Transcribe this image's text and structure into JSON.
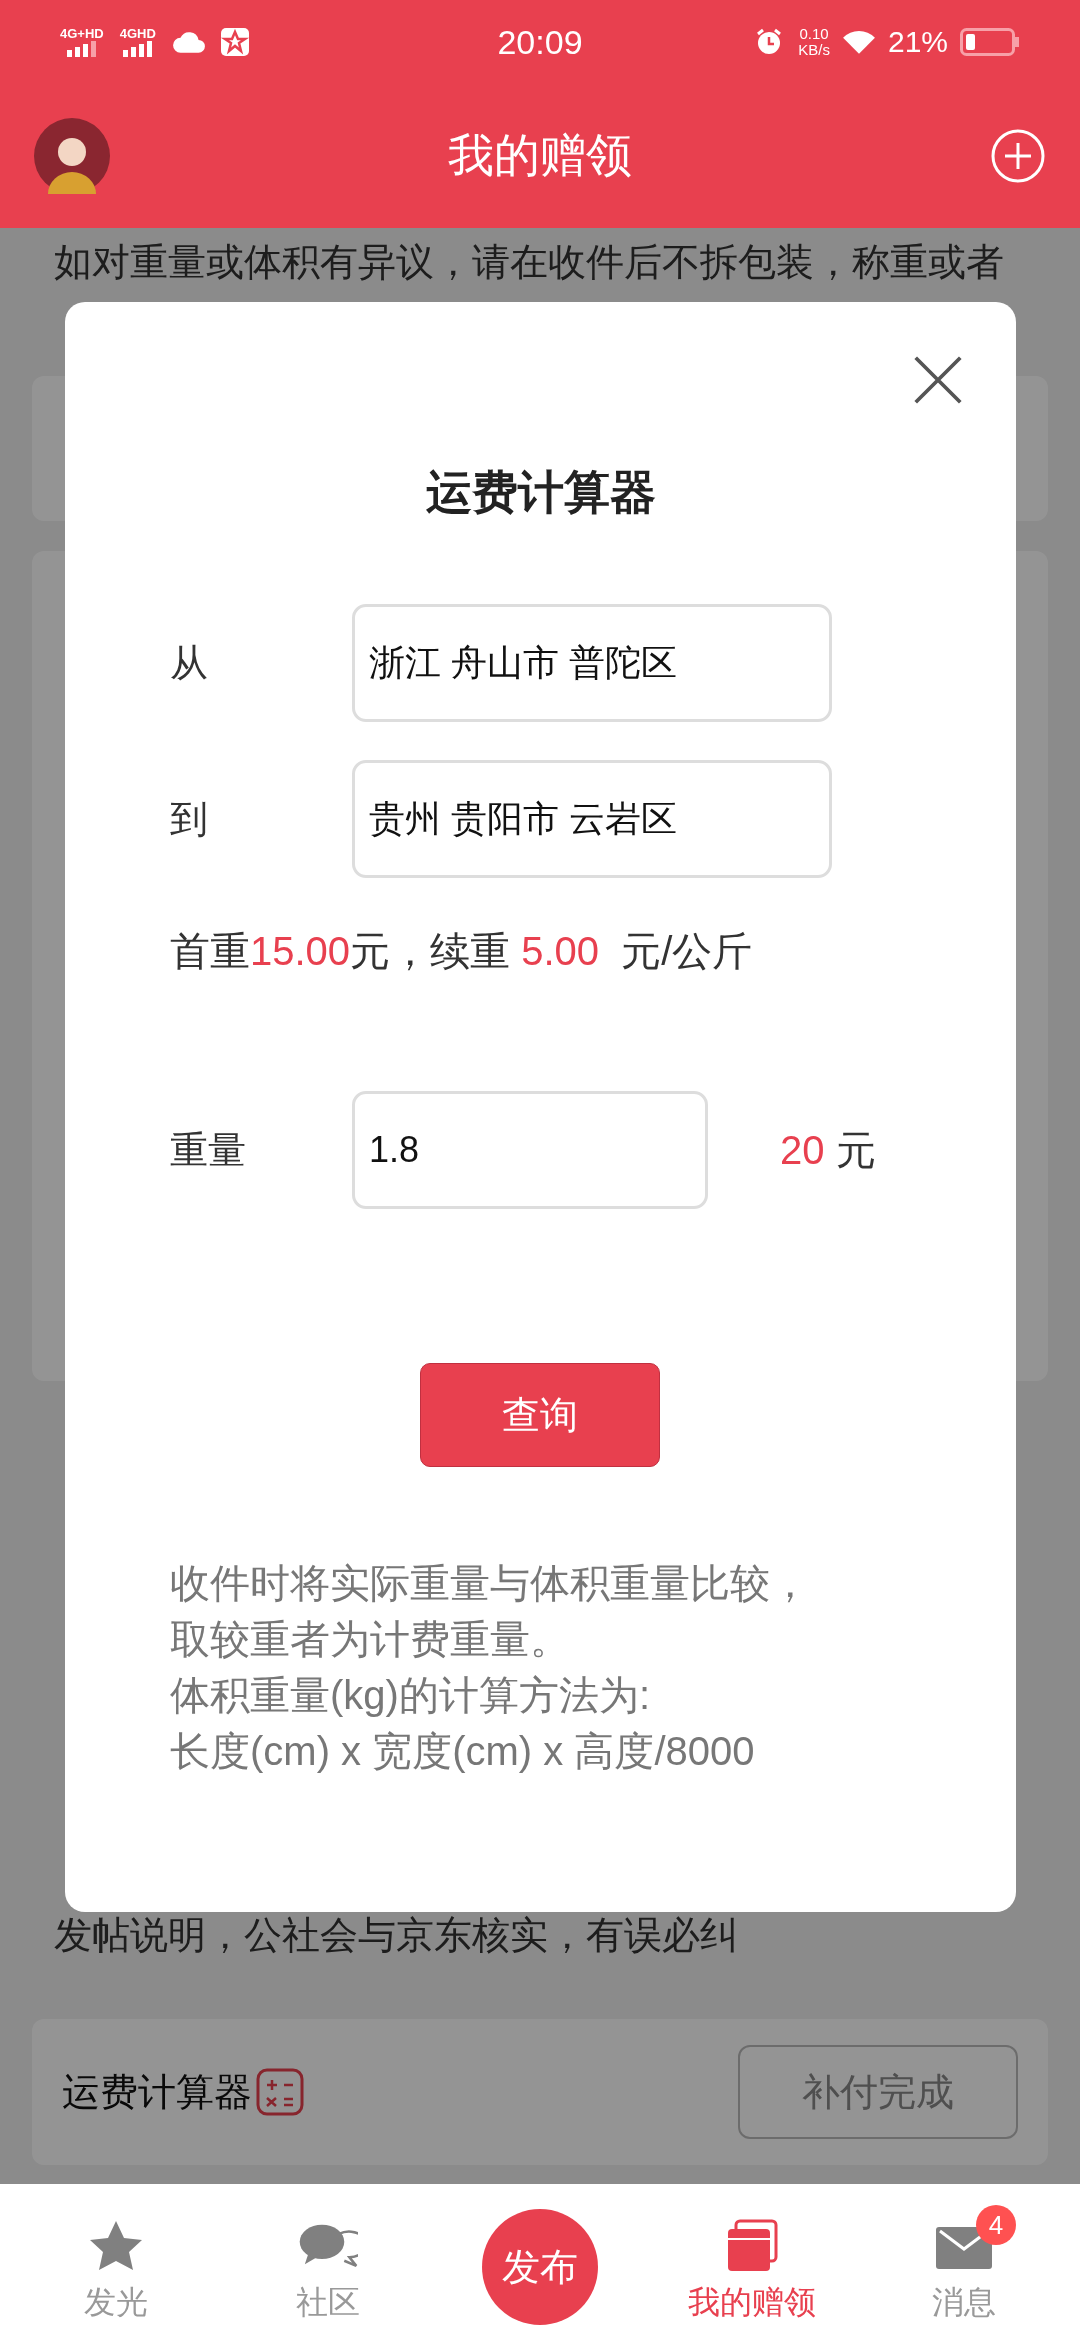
{
  "status_bar": {
    "signal_labels": [
      "4G+HD",
      "4GHD"
    ],
    "time": "20:09",
    "speed_value": "0.10",
    "speed_unit": "KB/s",
    "battery": "21%"
  },
  "header": {
    "title": "我的赠领"
  },
  "background": {
    "notice_top": "如对重量或体积有异议，请在收件后不拆包装，称重或者",
    "notice_bottom": "发帖说明，公社会与京东核实，有误必纠",
    "calculator_link": "运费计算器",
    "pay_button": "补付完成"
  },
  "dialog": {
    "title": "运费计算器",
    "from": {
      "label": "从",
      "value": "浙江 舟山市 普陀区"
    },
    "to": {
      "label": "到",
      "value": "贵州 贵阳市 云岩区"
    },
    "fee_parts": [
      {
        "text": "首重",
        "highlight": false
      },
      {
        "text": "15.00",
        "highlight": true
      },
      {
        "text": "元，续重 ",
        "highlight": false
      },
      {
        "text": "5.00",
        "highlight": true
      },
      {
        "text": "  元/公斤",
        "highlight": false
      }
    ],
    "weight": {
      "label": "重量",
      "value": "1.8"
    },
    "result": {
      "amount": "20",
      "unit": "元"
    },
    "query_button": "查询",
    "notes": [
      "收件时将实际重量与体积重量比较，",
      "取较重者为计费重量。",
      "体积重量(kg)的计算方法为:",
      "长度(cm) x 宽度(cm) x 高度/8000"
    ]
  },
  "tab_bar": [
    {
      "label": "发光",
      "kind": "tab",
      "selected": false
    },
    {
      "label": "社区",
      "kind": "tab",
      "selected": false
    },
    {
      "label": "发布",
      "kind": "publish",
      "selected": false
    },
    {
      "label": "我的赠领",
      "kind": "tab",
      "selected": true
    },
    {
      "label": "消息",
      "kind": "tab",
      "selected": false,
      "badge": "4"
    }
  ]
}
